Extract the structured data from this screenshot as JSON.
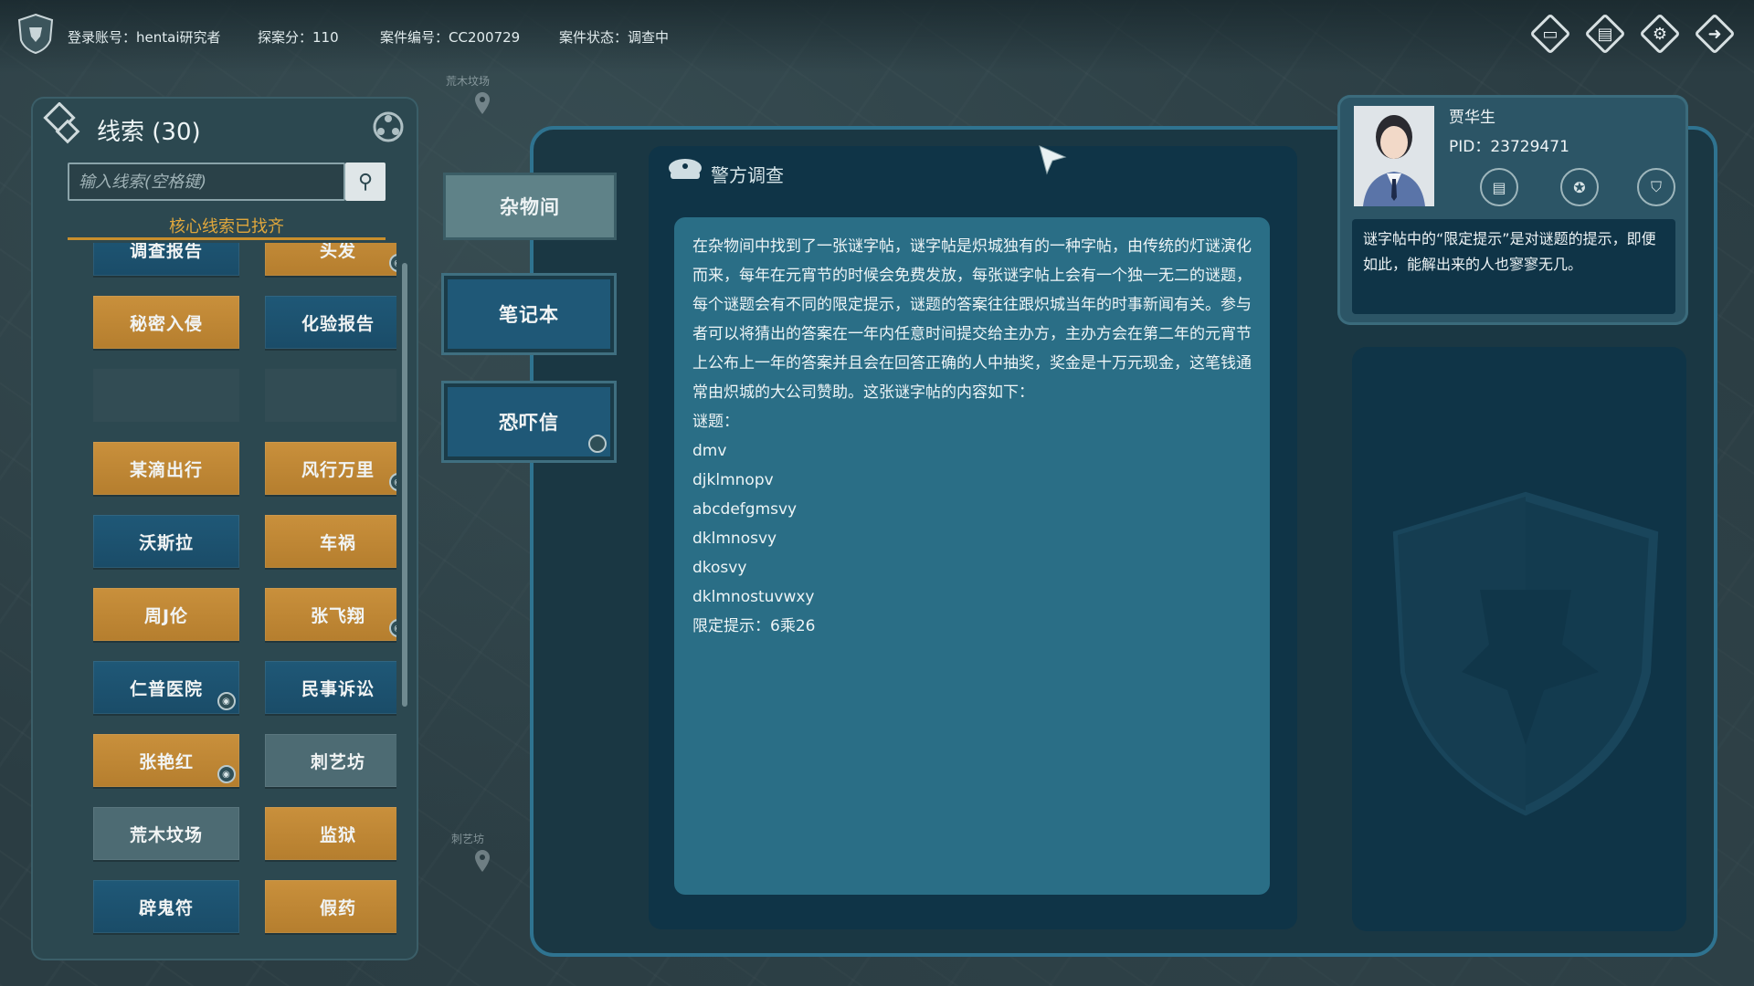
{
  "topbar": {
    "account": "登录账号：hentai研究者",
    "score": "探案分：110",
    "case_no": "案件编号：CC200729",
    "case_status": "案件状态：调查中",
    "icons": [
      "screen-icon",
      "case-folder-icon",
      "settings-icon",
      "exit-icon"
    ]
  },
  "clues_panel": {
    "title": "线索 (30)",
    "search_placeholder": "输入线索(空格键)",
    "core_status": "核心线索已找齐",
    "items": [
      {
        "label": "调查报告",
        "style": "blue",
        "badge": false
      },
      {
        "label": "头发",
        "style": "gold",
        "badge": true
      },
      {
        "label": "秘密入侵",
        "style": "gold",
        "badge": false
      },
      {
        "label": "化验报告",
        "style": "blue",
        "badge": false
      },
      {
        "label": "",
        "style": "empty",
        "badge": false
      },
      {
        "label": "",
        "style": "empty",
        "badge": false
      },
      {
        "label": "某滴出行",
        "style": "gold",
        "badge": false
      },
      {
        "label": "风行万里",
        "style": "gold",
        "badge": true
      },
      {
        "label": "沃斯拉",
        "style": "blue",
        "badge": false
      },
      {
        "label": "车祸",
        "style": "gold",
        "badge": false
      },
      {
        "label": "周J伦",
        "style": "gold",
        "badge": false
      },
      {
        "label": "张飞翔",
        "style": "gold",
        "badge": true
      },
      {
        "label": "仁普医院",
        "style": "blue",
        "badge": true
      },
      {
        "label": "民事诉讼",
        "style": "blue",
        "badge": false
      },
      {
        "label": "张艳红",
        "style": "gold",
        "badge": true
      },
      {
        "label": "刺艺坊",
        "style": "gray",
        "badge": false
      },
      {
        "label": "荒木坟场",
        "style": "gray",
        "badge": false
      },
      {
        "label": "监狱",
        "style": "gold",
        "badge": false
      },
      {
        "label": "辟鬼符",
        "style": "blue",
        "badge": false
      },
      {
        "label": "假药",
        "style": "gold",
        "badge": false
      }
    ]
  },
  "tabs": {
    "storeroom": "杂物间",
    "notebook": "笔记本",
    "threat_letter": "恐吓信"
  },
  "investigation": {
    "title": "警方调查",
    "paragraph": "在杂物间中找到了一张谜字帖，谜字帖是炽城独有的一种字帖，由传统的灯谜演化而来，每年在元宵节的时候会免费发放，每张谜字帖上会有一个独一无二的谜题，每个谜题会有不同的限定提示，谜题的答案往往跟炽城当年的时事新闻有关。参与者可以将猜出的答案在一年内任意时间提交给主办方，主办方会在第二年的元宵节上公布上一年的答案并且会在回答正确的人中抽奖，奖金是十万元现金，这笔钱通常由炽城的大公司赞助。这张谜字帖的内容如下：",
    "riddle_label": "谜题：",
    "riddle_lines": [
      "dmv",
      "djklmnopv",
      "abcdefgmsvy",
      "dklmnosvy",
      "dkosvy",
      "dklmnostuvwxy"
    ],
    "hint": "限定提示：6乘26"
  },
  "character": {
    "name": "贾华生",
    "pid": "PID：23729471",
    "icons": [
      "chat-icon",
      "badge-icon",
      "shield-icon"
    ],
    "dialog": "谜字帖中的“限定提示”是对谜题的提示，即便如此，能解出来的人也寥寥无几。"
  },
  "map": {
    "label1": "荒木坟场",
    "label2": "刺艺坊"
  },
  "colors": {
    "gold": "#c9903c",
    "blue": "#1f5877",
    "accent_orange": "#e0a73c",
    "panel_border": "#2f7390"
  }
}
